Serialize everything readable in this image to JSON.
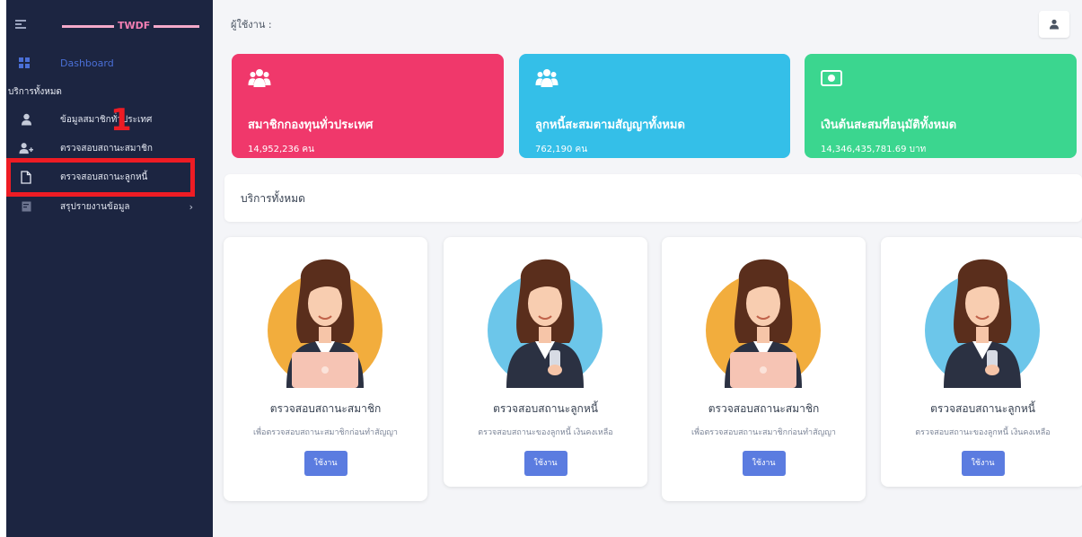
{
  "sidebar": {
    "brand": "TWDF",
    "dashboard": "Dashboard",
    "section_label": "บริการทั้งหมด",
    "items": [
      {
        "label": "ข้อมูลสมาชิกทั่วประเทศ",
        "icon": "user-icon"
      },
      {
        "label": "ตรวจสอบสถานะสมาชิก",
        "icon": "user-plus-icon"
      },
      {
        "label": "ตรวจสอบสถานะลูกหนี้",
        "icon": "document-icon"
      },
      {
        "label": "สรุปรายงานข้อมูล",
        "icon": "report-icon"
      }
    ],
    "annotation_number": "1",
    "highlight_color": "#ee1c24"
  },
  "header": {
    "user_label": "ผู้ใช้งาน :",
    "user_icon": "user-icon"
  },
  "stats": [
    {
      "title": "สมาชิกกองทุนทั่วประเทศ",
      "value": "14,952,236 คน",
      "color": "#f0386b",
      "icon": "users-icon"
    },
    {
      "title": "ลูกหนี้สะสมตามสัญญาทั้งหมด",
      "value": "762,190 คน",
      "color": "#34bfe8",
      "icon": "users-icon"
    },
    {
      "title": "เงินต้นสะสมที่อนุมัติทั้งหมด",
      "value": "14,346,435,781.69 บาท",
      "color": "#3bd68f",
      "icon": "money-icon"
    }
  ],
  "services": {
    "header": "บริการทั้งหมด",
    "cards": [
      {
        "title": "ตรวจสอบสถานะสมาชิก",
        "desc": "เพื่อตรวจสอบสถานะสมาชิกก่อนทำสัญญา",
        "button": "ใช้งาน",
        "illustration": "woman-laptop-icon",
        "bg": "#f2ad3d"
      },
      {
        "title": "ตรวจสอบสถานะลูกหนี้",
        "desc": "ตรวจสอบสถานะของลูกหนี้ เงินคงเหลือ",
        "button": "ใช้งาน",
        "illustration": "woman-phone-icon",
        "bg": "#6cc6ea"
      },
      {
        "title": "ตรวจสอบสถานะสมาชิก",
        "desc": "เพื่อตรวจสอบสถานะสมาชิกก่อนทำสัญญา",
        "button": "ใช้งาน",
        "illustration": "woman-laptop-icon",
        "bg": "#f2ad3d"
      },
      {
        "title": "ตรวจสอบสถานะลูกหนี้",
        "desc": "ตรวจสอบสถานะของลูกหนี้ เงินคงเหลือ",
        "button": "ใช้งาน",
        "illustration": "woman-phone-icon",
        "bg": "#6cc6ea"
      }
    ]
  }
}
